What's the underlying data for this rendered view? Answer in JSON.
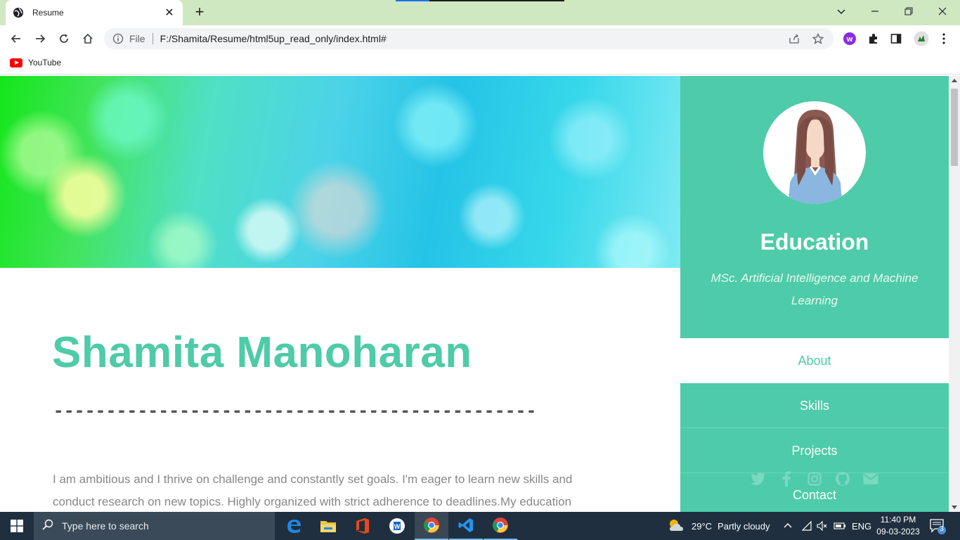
{
  "browser": {
    "tab_title": "Resume",
    "new_tab_label": "+",
    "url_scheme": "File",
    "url": "F:/Shamita/Resume/html5up_read_only/index.html#",
    "bookmarks": [
      {
        "label": "YouTube",
        "icon": "youtube-icon"
      }
    ]
  },
  "page": {
    "name": "Shamita Manoharan",
    "divider": "----------------------------------------------",
    "about": "I am ambitious and I thrive on challenge and constantly set goals. I'm eager to learn new skills and conduct research on new topics. Highly organized with strict adherence to deadlines.My education",
    "sidebar": {
      "title": "Education",
      "subtitle": "MSc. Artificial Intelligence and Machine Learning",
      "nav": [
        {
          "label": "About",
          "active": true
        },
        {
          "label": "Skills",
          "active": false
        },
        {
          "label": "Projects",
          "active": false
        }
      ],
      "contact_label": "Contact",
      "social": [
        "twitter-icon",
        "facebook-icon",
        "instagram-icon",
        "github-icon",
        "envelope-icon"
      ]
    },
    "colors": {
      "accent": "#4ecba8",
      "body_text": "#888888"
    }
  },
  "taskbar": {
    "search_placeholder": "Type here to search",
    "apps": [
      "edge-icon",
      "file-explorer-icon",
      "office-icon",
      "wps-icon",
      "chrome-icon",
      "vscode-icon",
      "chrome-icon"
    ],
    "weather": {
      "temp": "29°C",
      "condition": "Partly cloudy"
    },
    "language": "ENG",
    "time": "11:40 PM",
    "date": "09-03-2023",
    "notification_count": "3"
  }
}
